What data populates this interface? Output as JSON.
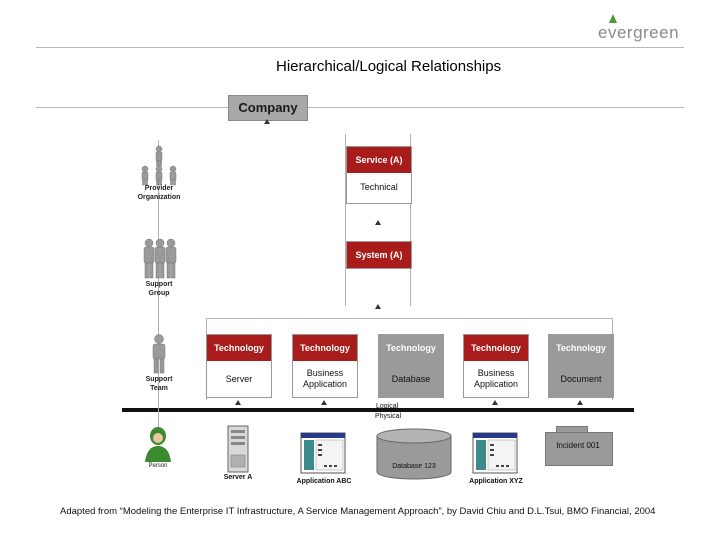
{
  "brand": {
    "logo_text": "evergreen",
    "accent": "#4a9a32"
  },
  "title": "Hierarchical/Logical Relationships",
  "company": "Company",
  "service": {
    "header": "Service (A)",
    "body": "Technical"
  },
  "system": {
    "header": "System (A)"
  },
  "technologies": [
    {
      "header": "Technology",
      "body": "Server",
      "shaded": false
    },
    {
      "header": "Technology",
      "body": "Business Application",
      "shaded": false
    },
    {
      "header": "Technology",
      "body": "Database",
      "shaded": true
    },
    {
      "header": "Technology",
      "body": "Business Application",
      "shaded": false
    },
    {
      "header": "Technology",
      "body": "Document",
      "shaded": true
    }
  ],
  "roles": {
    "provider": "Provider Organization",
    "support_group": "Support Group",
    "support_team": "Support Team",
    "person": "Person"
  },
  "divider": {
    "logical": "Logical",
    "physical": "Physical"
  },
  "items": {
    "server": "Server A",
    "app_abc": "Application ABC",
    "database": "Database 123",
    "app_xyz": "Application XYZ",
    "incident": "Incident 001"
  },
  "caption": "Adapted from “Modeling the Enterprise IT Infrastructure, A Service Management Approach”, by David Chiu and D.L.Tsui, BMO Financial, 2004",
  "colors": {
    "header_red": "#a81c1c",
    "shade_grey": "#9a9a9a"
  }
}
